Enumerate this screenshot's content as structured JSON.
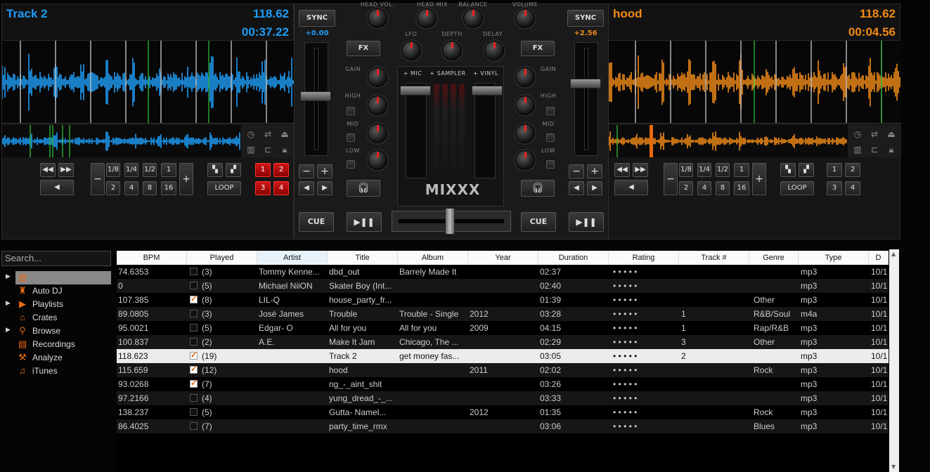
{
  "deck1": {
    "title": "Track 2",
    "bpm": "118.62",
    "time": "00:37.22",
    "rate": "+0.00",
    "color": "#1f9cf5",
    "sync": "SYNC",
    "cue": "CUE",
    "loop": "LOOP",
    "beatloops_top": [
      "1/8",
      "1/4",
      "1/2",
      "1"
    ],
    "beatloops_bottom": [
      "2",
      "4",
      "8",
      "16"
    ],
    "hotcues": [
      "1",
      "2",
      "3",
      "4"
    ]
  },
  "deck2": {
    "title": "hood",
    "bpm": "118.62",
    "time": "00:04.56",
    "rate": "+2.56",
    "color": "#f08a18",
    "sync": "SYNC",
    "cue": "CUE",
    "loop": "LOOP",
    "beatloops_top": [
      "1/8",
      "1/4",
      "1/2",
      "1"
    ],
    "beatloops_bottom": [
      "2",
      "4",
      "8",
      "16"
    ],
    "hotcues": [
      "1",
      "2",
      "3",
      "4"
    ]
  },
  "mixer": {
    "head_vol": "HEAD VOL.",
    "head_mix": "HEAD MIX",
    "balance": "BALANCE",
    "volume": "VOLUME",
    "fx": "FX",
    "lfo": "LFO",
    "depth": "DEPTH",
    "delay": "DELAY",
    "gain": "GAIN",
    "high": "HIGH",
    "mid": "MID",
    "low": "LOW",
    "mic": "+ MIC",
    "sampler": "+ SAMPLER",
    "vinyl": "+ VINYL",
    "logo": "MIXXX"
  },
  "sidebar": {
    "search_placeholder": "Search...",
    "items": [
      {
        "label": "Library",
        "icon": "library-icon"
      },
      {
        "label": "Auto DJ",
        "icon": "robot-icon"
      },
      {
        "label": "Playlists",
        "icon": "playlist-icon"
      },
      {
        "label": "Crates",
        "icon": "crate-icon"
      },
      {
        "label": "Browse",
        "icon": "search-icon"
      },
      {
        "label": "Recordings",
        "icon": "recordings-icon"
      },
      {
        "label": "Analyze",
        "icon": "analyze-icon"
      },
      {
        "label": "iTunes",
        "icon": "music-note-icon"
      }
    ]
  },
  "table": {
    "columns": [
      "BPM",
      "Played",
      "Artist",
      "Title",
      "Album",
      "Year",
      "Duration",
      "Rating",
      "Track #",
      "Genre",
      "Type",
      "D"
    ],
    "rows": [
      {
        "bpm": "74.6353",
        "checked": false,
        "played": "(3)",
        "artist": "Tommy Kenne...",
        "title": "dbd_out",
        "album": "Barrely Made It",
        "year": "",
        "duration": "02:37",
        "rating": "• • • • •",
        "track": "",
        "genre": "",
        "type": "mp3",
        "date": "10/1"
      },
      {
        "bpm": "0",
        "checked": false,
        "played": "(5)",
        "artist": "Michael NiiON",
        "title": "Skater Boy (Int...",
        "album": "",
        "year": "",
        "duration": "02:40",
        "rating": "• • • • •",
        "track": "",
        "genre": "",
        "type": "mp3",
        "date": "10/1"
      },
      {
        "bpm": "107.385",
        "checked": true,
        "played": "(8)",
        "artist": "LIL-Q",
        "title": "house_party_fr...",
        "album": "",
        "year": "",
        "duration": "01:39",
        "rating": "• • • • •",
        "track": "",
        "genre": "Other",
        "type": "mp3",
        "date": "10/1"
      },
      {
        "bpm": "89.0805",
        "checked": false,
        "played": "(3)",
        "artist": "José James",
        "title": "Trouble",
        "album": "Trouble - Single",
        "year": "2012",
        "duration": "03:28",
        "rating": "• • • • •",
        "track": "1",
        "genre": "R&B/Soul",
        "type": "m4a",
        "date": "10/1"
      },
      {
        "bpm": "95.0021",
        "checked": false,
        "played": "(5)",
        "artist": "Edgar- O",
        "title": "All for you",
        "album": "All for you",
        "year": "2009",
        "duration": "04:15",
        "rating": "• • • • •",
        "track": "1",
        "genre": "Rap/R&B",
        "type": "mp3",
        "date": "10/1"
      },
      {
        "bpm": "100.837",
        "checked": false,
        "played": "(2)",
        "artist": "A.E.",
        "title": "Make It Jam",
        "album": "Chicago, The ...",
        "year": "",
        "duration": "02:29",
        "rating": "• • • • •",
        "track": "3",
        "genre": "Other",
        "type": "mp3",
        "date": "10/1"
      },
      {
        "bpm": "118.623",
        "checked": true,
        "played": "(19)",
        "artist": "",
        "title": "Track 2",
        "album": "get money fas...",
        "year": "",
        "duration": "03:05",
        "rating": "• • • • •",
        "track": "2",
        "genre": "",
        "type": "mp3",
        "date": "10/1"
      },
      {
        "bpm": "115.659",
        "checked": true,
        "played": "(12)",
        "artist": "",
        "title": "hood",
        "album": "",
        "year": "2011",
        "duration": "02:02",
        "rating": "• • • • •",
        "track": "",
        "genre": "Rock",
        "type": "mp3",
        "date": "10/1"
      },
      {
        "bpm": "93.0268",
        "checked": true,
        "played": "(7)",
        "artist": "",
        "title": "ng_-_aint_shit",
        "album": "",
        "year": "",
        "duration": "03:26",
        "rating": "• • • • •",
        "track": "",
        "genre": "",
        "type": "mp3",
        "date": "10/1"
      },
      {
        "bpm": "97.2166",
        "checked": false,
        "played": "(4)",
        "artist": "",
        "title": "yung_dread_-_...",
        "album": "",
        "year": "",
        "duration": "03:33",
        "rating": "• • • • •",
        "track": "",
        "genre": "",
        "type": "mp3",
        "date": "10/1"
      },
      {
        "bpm": "138.237",
        "checked": false,
        "played": "(5)",
        "artist": "",
        "title": "Gutta- Namel...",
        "album": "",
        "year": "2012",
        "duration": "01:35",
        "rating": "• • • • •",
        "track": "",
        "genre": "Rock",
        "type": "mp3",
        "date": "10/1"
      },
      {
        "bpm": "86.4025",
        "checked": false,
        "played": "(7)",
        "artist": "",
        "title": "party_time_rmx",
        "album": "",
        "year": "",
        "duration": "03:06",
        "rating": "• • • • •",
        "track": "",
        "genre": "Blues",
        "type": "mp3",
        "date": "10/1"
      }
    ]
  }
}
